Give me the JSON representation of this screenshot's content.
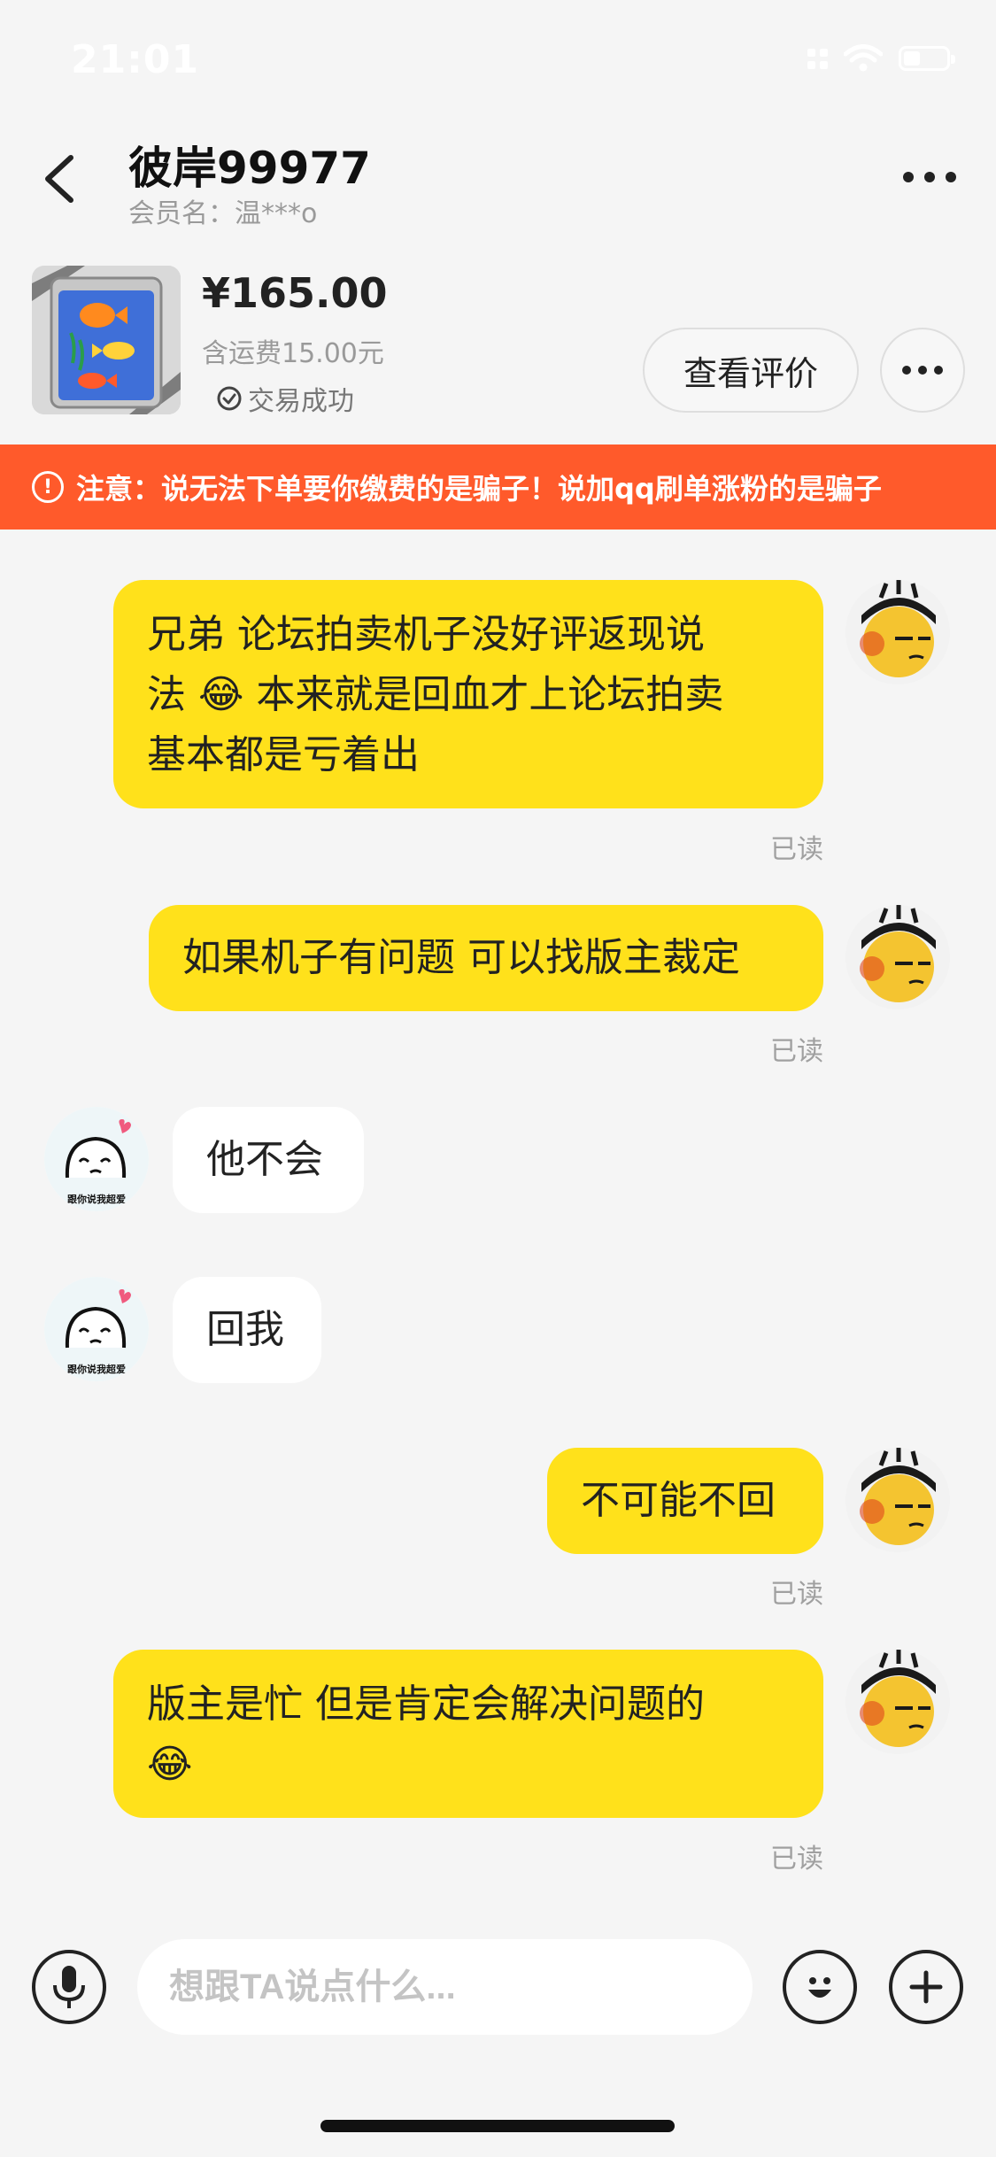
{
  "status_bar": {
    "time": "21:01"
  },
  "header": {
    "peer_name": "彼岸99977",
    "member_label": "会员名：温***o"
  },
  "product": {
    "price": "¥165.00",
    "shipping": "含运费15.00元",
    "status": "交易成功",
    "review_button": "查看评价"
  },
  "warning": {
    "text": "注意：说无法下单要你缴费的是骗子！说加qq刷单涨粉的是骗子"
  },
  "messages": [
    {
      "direction": "out",
      "lines": [
        "兄弟 论坛拍卖机子没好评返现说",
        "法 😂 本来就是回血才上论坛拍卖",
        "基本都是亏着出"
      ],
      "read": "已读"
    },
    {
      "direction": "out",
      "lines": [
        "如果机子有问题 可以找版主裁定"
      ],
      "read": "已读"
    },
    {
      "direction": "in",
      "lines": [
        "他不会"
      ]
    },
    {
      "direction": "in",
      "lines": [
        "回我"
      ]
    },
    {
      "direction": "out",
      "lines": [
        "不可能不回"
      ],
      "read": "已读"
    },
    {
      "direction": "out",
      "lines": [
        "版主是忙 但是肯定会解决问题的",
        "😂"
      ],
      "read": "已读"
    }
  ],
  "peer_avatar_caption": "跟你说我超爱",
  "input": {
    "placeholder": "想跟TA说点什么..."
  },
  "colors": {
    "outgoing_bubble": "#ffe11b",
    "incoming_bubble": "#ffffff",
    "warning_bg": "#ff5a2b",
    "page_bg": "#f5f5f5"
  },
  "icons": [
    "back-arrow-icon",
    "more-dots-icon",
    "check-circle-icon",
    "exclamation-icon",
    "microphone-icon",
    "smiley-icon",
    "plus-icon"
  ]
}
